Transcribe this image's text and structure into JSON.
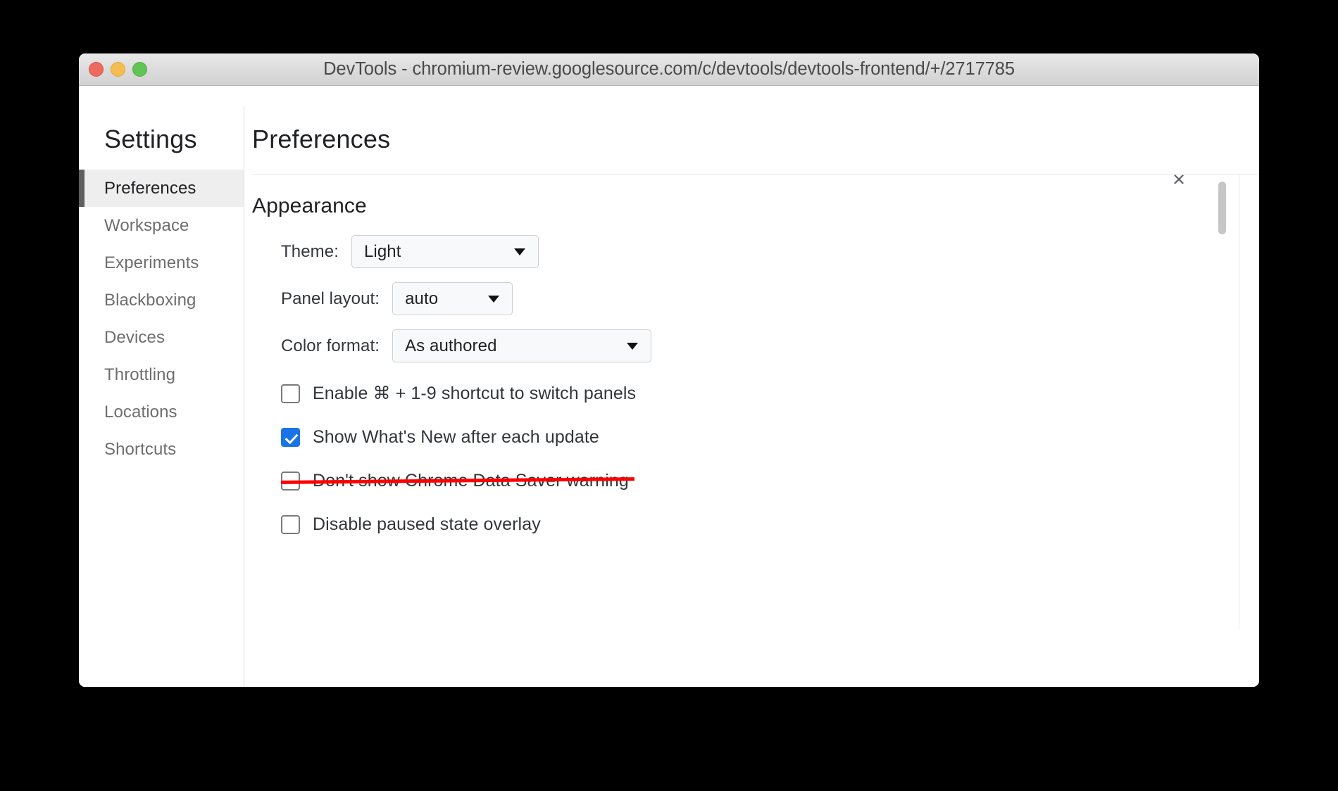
{
  "window": {
    "title": "DevTools - chromium-review.googlesource.com/c/devtools/devtools-frontend/+/2717785",
    "traffic_lights": {
      "close": "close-window",
      "minimize": "minimize-window",
      "maximize": "maximize-window"
    }
  },
  "sidebar": {
    "title": "Settings",
    "items": [
      {
        "label": "Preferences",
        "selected": true
      },
      {
        "label": "Workspace",
        "selected": false
      },
      {
        "label": "Experiments",
        "selected": false
      },
      {
        "label": "Blackboxing",
        "selected": false
      },
      {
        "label": "Devices",
        "selected": false
      },
      {
        "label": "Throttling",
        "selected": false
      },
      {
        "label": "Locations",
        "selected": false
      },
      {
        "label": "Shortcuts",
        "selected": false
      }
    ]
  },
  "main": {
    "title": "Preferences",
    "close_label": "×",
    "section_title": "Appearance",
    "fields": [
      {
        "label": "Theme:",
        "value": "Light"
      },
      {
        "label": "Panel layout:",
        "value": "auto"
      },
      {
        "label": "Color format:",
        "value": "As authored"
      }
    ],
    "checkboxes": [
      {
        "label": "Enable ⌘ + 1-9 shortcut to switch panels",
        "checked": false,
        "struck": false
      },
      {
        "label": "Show What's New after each update",
        "checked": true,
        "struck": false
      },
      {
        "label": "Don't show Chrome Data Saver warning",
        "checked": false,
        "struck": true
      },
      {
        "label": "Disable paused state overlay",
        "checked": false,
        "struck": false
      }
    ]
  },
  "colors": {
    "accent": "#1a73e8",
    "strike": "#ff0000",
    "selected_row_bg": "#eeeeee",
    "selected_row_marker": "#5f5f5f",
    "text_primary": "#202124",
    "text_muted": "#6e6e6e"
  }
}
